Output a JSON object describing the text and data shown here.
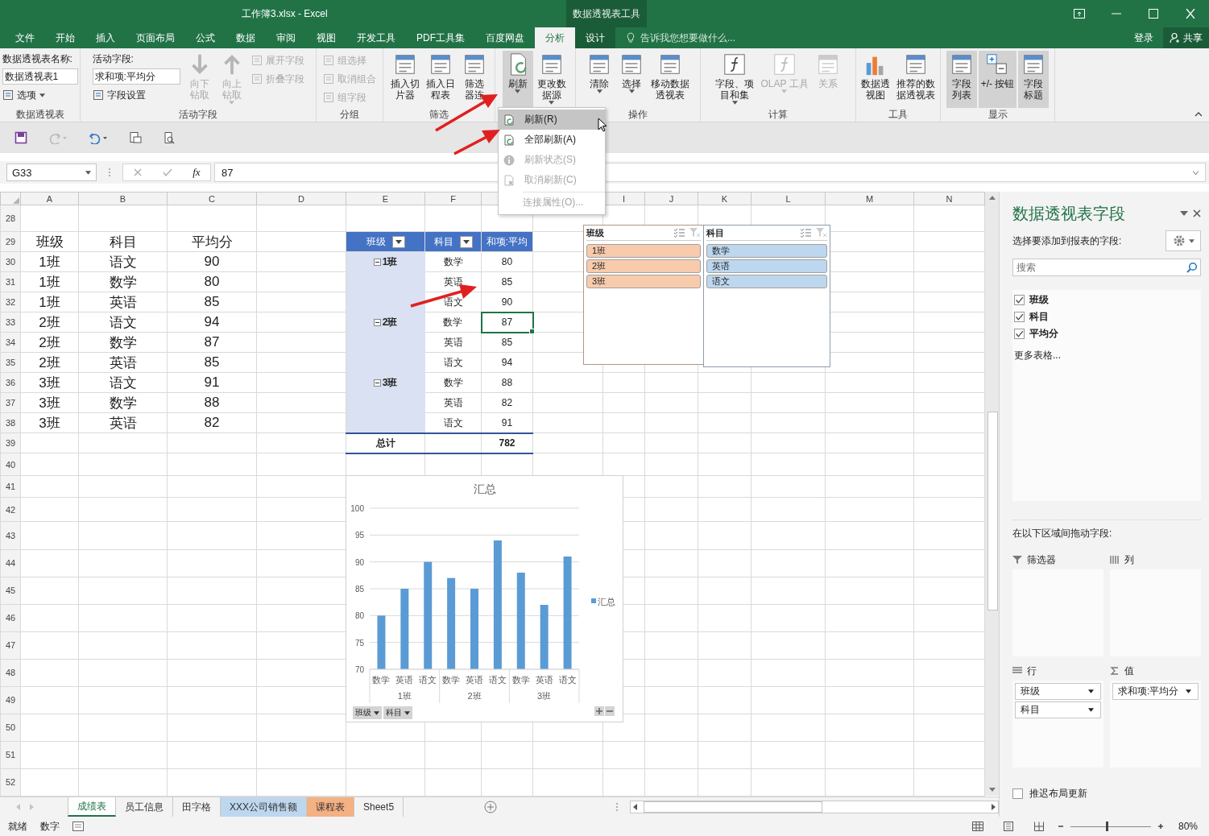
{
  "window": {
    "title": "工作簿3.xlsx - Excel",
    "context_tab": "数据透视表工具"
  },
  "menu_tabs": [
    {
      "label": "文件",
      "selected": false,
      "contextual": false
    },
    {
      "label": "开始",
      "selected": false,
      "contextual": false
    },
    {
      "label": "插入",
      "selected": false,
      "contextual": false
    },
    {
      "label": "页面布局",
      "selected": false,
      "contextual": false
    },
    {
      "label": "公式",
      "selected": false,
      "contextual": false
    },
    {
      "label": "数据",
      "selected": false,
      "contextual": false
    },
    {
      "label": "审阅",
      "selected": false,
      "contextual": false
    },
    {
      "label": "视图",
      "selected": false,
      "contextual": false
    },
    {
      "label": "开发工具",
      "selected": false,
      "contextual": false
    },
    {
      "label": "PDF工具集",
      "selected": false,
      "contextual": false
    },
    {
      "label": "百度网盘",
      "selected": false,
      "contextual": false
    },
    {
      "label": "分析",
      "selected": true,
      "contextual": true
    },
    {
      "label": "设计",
      "selected": false,
      "contextual": true
    }
  ],
  "tell_me": {
    "placeholder": "告诉我您想要做什么..."
  },
  "account": {
    "sign_in": "登录",
    "share": "共享"
  },
  "ribbon": {
    "groups": [
      {
        "label": "数据透视表",
        "items": [
          {
            "kind": "stack",
            "items": [
              {
                "kind": "caption",
                "text": "数据透视表名称:"
              },
              {
                "kind": "input",
                "value": "数据透视表1"
              },
              {
                "kind": "small",
                "label": "选项",
                "disabled": false,
                "dropdown": true
              }
            ]
          }
        ]
      },
      {
        "label": "活动字段",
        "items": [
          {
            "kind": "stack",
            "items": [
              {
                "kind": "caption",
                "text": "活动字段:"
              },
              {
                "kind": "input",
                "value": "求和项:平均分"
              },
              {
                "kind": "small",
                "label": "字段设置",
                "disabled": false,
                "dropdown": false
              }
            ]
          },
          {
            "kind": "large",
            "label": "向下钻取",
            "disabled": true,
            "selected": false,
            "dropdown": false
          },
          {
            "kind": "large",
            "label": "向上钻取",
            "disabled": true,
            "selected": false,
            "dropdown": true
          },
          {
            "kind": "stack",
            "items": [
              {
                "kind": "small",
                "label": "展开字段",
                "disabled": true,
                "dropdown": false
              },
              {
                "kind": "small",
                "label": "折叠字段",
                "disabled": true,
                "dropdown": false
              }
            ]
          }
        ]
      },
      {
        "label": "分组",
        "items": [
          {
            "kind": "stack",
            "items": [
              {
                "kind": "small",
                "label": "组选择",
                "disabled": true,
                "dropdown": false
              },
              {
                "kind": "small",
                "label": "取消组合",
                "disabled": true,
                "dropdown": false
              },
              {
                "kind": "small",
                "label": "组字段",
                "disabled": true,
                "dropdown": false
              }
            ]
          }
        ]
      },
      {
        "label": "筛选",
        "items": [
          {
            "kind": "large",
            "label": "插入切片器",
            "disabled": false,
            "selected": false,
            "dropdown": false
          },
          {
            "kind": "large",
            "label": "插入日程表",
            "disabled": false,
            "selected": false,
            "dropdown": false
          },
          {
            "kind": "large",
            "label": "筛选器连",
            "disabled": false,
            "selected": false,
            "dropdown": false
          }
        ]
      },
      {
        "items": [
          {
            "kind": "large",
            "label": "刷新",
            "disabled": false,
            "selected": true,
            "dropdown": true
          },
          {
            "kind": "large",
            "label": "更改数据源",
            "disabled": false,
            "selected": false,
            "dropdown": true
          }
        ]
      },
      {
        "label": "操作",
        "items": [
          {
            "kind": "large",
            "label": "清除",
            "disabled": false,
            "selected": false,
            "dropdown": true
          },
          {
            "kind": "large",
            "label": "选择",
            "disabled": false,
            "selected": false,
            "dropdown": true
          },
          {
            "kind": "large",
            "label": "移动数据透视表",
            "disabled": false,
            "selected": false,
            "dropdown": false
          }
        ]
      },
      {
        "label": "计算",
        "items": [
          {
            "kind": "large",
            "label": "字段、项目和集",
            "disabled": false,
            "selected": false,
            "dropdown": true
          },
          {
            "kind": "large",
            "label": "OLAP 工具",
            "disabled": true,
            "selected": false,
            "dropdown": true
          },
          {
            "kind": "large",
            "label": "关系",
            "disabled": true,
            "selected": false,
            "dropdown": false
          }
        ]
      },
      {
        "label": "工具",
        "items": [
          {
            "kind": "large",
            "label": "数据透视图",
            "disabled": false,
            "selected": false,
            "dropdown": false
          },
          {
            "kind": "large",
            "label": "推荐的数据透视表",
            "disabled": false,
            "selected": false,
            "dropdown": false
          }
        ]
      },
      {
        "label": "显示",
        "items": [
          {
            "kind": "large",
            "label": "字段列表",
            "disabled": false,
            "selected": true,
            "dropdown": false
          },
          {
            "kind": "large",
            "label": "+/- 按钮",
            "disabled": false,
            "selected": true,
            "dropdown": false
          },
          {
            "kind": "large",
            "label": "字段标题",
            "disabled": false,
            "selected": true,
            "dropdown": false
          }
        ]
      }
    ]
  },
  "refresh_menu": {
    "items": [
      {
        "label": "刷新(R)",
        "selected": true,
        "disabled": false
      },
      {
        "label": "全部刷新(A)",
        "selected": false,
        "disabled": false
      },
      {
        "label": "刷新状态(S)",
        "selected": false,
        "disabled": true
      },
      {
        "label": "取消刷新(C)",
        "selected": false,
        "disabled": true
      },
      {
        "label": "连接属性(O)...",
        "selected": false,
        "disabled": true
      }
    ]
  },
  "formula_bar": {
    "name_box": "G33",
    "function_label": "fx",
    "value": "87"
  },
  "sheet": {
    "column_headers_left": [
      "A",
      "B",
      "C",
      "D",
      "E",
      "F"
    ],
    "column_headers_right": [
      "I",
      "J",
      "K",
      "L",
      "M",
      "N"
    ],
    "row_numbers": [
      "28",
      "29",
      "30",
      "31",
      "32",
      "33",
      "34",
      "35",
      "36",
      "37",
      "38",
      "39",
      "40",
      "41",
      "42",
      "43",
      "44",
      "45",
      "46",
      "47",
      "48",
      "49",
      "50",
      "51",
      "52"
    ]
  },
  "data_table": {
    "header": [
      "班级",
      "科目",
      "平均分"
    ],
    "rows": [
      [
        "1班",
        "语文",
        "90"
      ],
      [
        "1班",
        "数学",
        "80"
      ],
      [
        "1班",
        "英语",
        "85"
      ],
      [
        "2班",
        "语文",
        "94"
      ],
      [
        "2班",
        "数学",
        "87"
      ],
      [
        "2班",
        "英语",
        "85"
      ],
      [
        "3班",
        "语文",
        "91"
      ],
      [
        "3班",
        "数学",
        "88"
      ],
      [
        "3班",
        "英语",
        "82"
      ]
    ]
  },
  "pivot_table": {
    "header": [
      {
        "label": "班级",
        "filter": true
      },
      {
        "label": "科目",
        "filter": true
      },
      {
        "label": "和项:平均",
        "filter": false
      }
    ],
    "groups": [
      {
        "label": "1班",
        "expanded": true,
        "rows": [
          {
            "subject": "数学",
            "value": "80",
            "selected": false
          },
          {
            "subject": "英语",
            "value": "85",
            "selected": false
          },
          {
            "subject": "语文",
            "value": "90",
            "selected": false
          }
        ]
      },
      {
        "label": "2班",
        "expanded": true,
        "rows": [
          {
            "subject": "数学",
            "value": "87",
            "selected": true
          },
          {
            "subject": "英语",
            "value": "85",
            "selected": false
          },
          {
            "subject": "语文",
            "value": "94",
            "selected": false
          }
        ]
      },
      {
        "label": "3班",
        "expanded": true,
        "rows": [
          {
            "subject": "数学",
            "value": "88",
            "selected": false
          },
          {
            "subject": "英语",
            "value": "82",
            "selected": false
          },
          {
            "subject": "语文",
            "value": "91",
            "selected": false
          }
        ]
      }
    ],
    "total": {
      "label": "总计",
      "value": "782"
    }
  },
  "slicers": [
    {
      "title": "班级",
      "color": "#f8cbad",
      "items": [
        {
          "label": "1班",
          "selected": true
        },
        {
          "label": "2班",
          "selected": true
        },
        {
          "label": "3班",
          "selected": true
        }
      ]
    },
    {
      "title": "科目",
      "color": "#bdd7ee",
      "items": [
        {
          "label": "数学",
          "selected": true
        },
        {
          "label": "英语",
          "selected": true
        },
        {
          "label": "语文",
          "selected": true
        }
      ]
    }
  ],
  "chart": {
    "field_buttons": [
      "班级",
      "科目"
    ],
    "chart_data": {
      "type": "bar",
      "title": "汇总",
      "categories": [
        "数学",
        "英语",
        "语文",
        "数学",
        "英语",
        "语文",
        "数学",
        "英语",
        "语文"
      ],
      "annotations": [
        {
          "text": "1班"
        },
        {
          "text": "2班"
        },
        {
          "text": "3班"
        }
      ],
      "grid": true,
      "series": [
        {
          "name": "汇总",
          "color": "#5b9bd5",
          "values": [
            80,
            85,
            90,
            87,
            85,
            94,
            88,
            82,
            91
          ]
        }
      ],
      "ylim": [
        70,
        100
      ],
      "yticks": [
        70,
        75,
        80,
        85,
        90,
        95,
        100
      ]
    }
  },
  "field_pane": {
    "title": "数据透视表字段",
    "subtitle": "选择要添加到报表的字段:",
    "search": {
      "placeholder": "搜索"
    },
    "fields": [
      {
        "label": "班级",
        "checked": true
      },
      {
        "label": "科目",
        "checked": true
      },
      {
        "label": "平均分",
        "checked": true
      }
    ],
    "more_tables": "更多表格...",
    "areas_hint": "在以下区域间拖动字段:",
    "areas": [
      {
        "label": "筛选器",
        "kind": "filter"
      },
      {
        "label": "列",
        "kind": "columns"
      },
      {
        "label": "行",
        "kind": "rows",
        "items": [
          "班级",
          "科目"
        ]
      },
      {
        "label": "值",
        "kind": "values",
        "items": [
          "求和项:平均分"
        ]
      }
    ],
    "defer_update": {
      "label": "推迟布局更新",
      "checked": false
    }
  },
  "sheet_tabs": [
    {
      "label": "成绩表",
      "selected": true
    },
    {
      "label": "员工信息",
      "selected": false
    },
    {
      "label": "田字格",
      "selected": false
    },
    {
      "label": "XXX公司销售额",
      "selected": false,
      "color": "#bdd7ee"
    },
    {
      "label": "课程表",
      "selected": false,
      "color": "#f4b183"
    },
    {
      "label": "Sheet5",
      "selected": false
    }
  ],
  "status_bar": {
    "items": [
      "就绪",
      "数字"
    ],
    "zoom": {
      "level": 0.45,
      "reading": "80%"
    }
  }
}
